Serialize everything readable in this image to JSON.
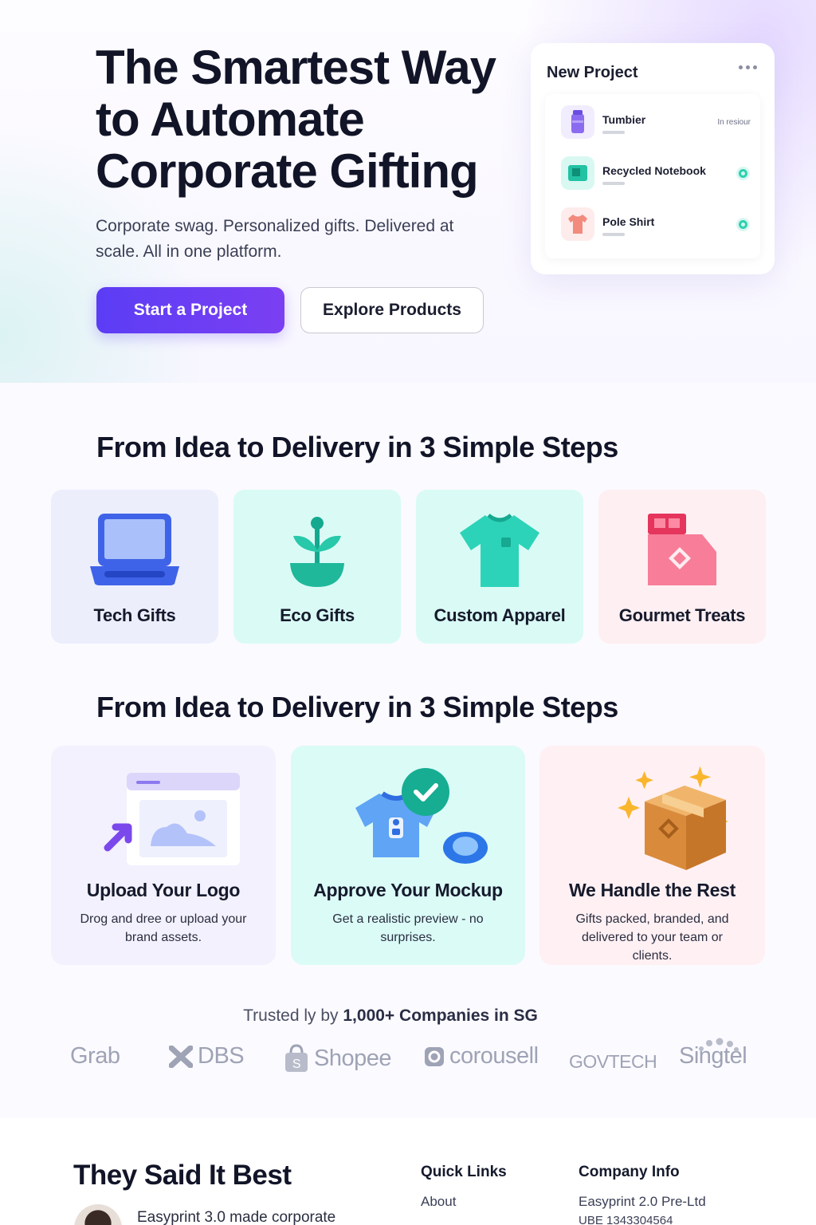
{
  "hero": {
    "title": "The Smartest Way to Automate Corporate Gifting",
    "subtitle": "Corporate swag. Personalized gifts. Delivered at scale. All in one platform.",
    "primary_cta": "Start a Project",
    "secondary_cta": "Explore Products"
  },
  "project_card": {
    "title": "New Project",
    "items": [
      {
        "name": "Tumbier",
        "status": "In resiour",
        "color": "#8b6cf0"
      },
      {
        "name": "Recycled Notebook",
        "status": "",
        "color": "#2fd1b0"
      },
      {
        "name": "Pole Shirt",
        "status": "",
        "color": "#f28b7d"
      }
    ]
  },
  "categories": {
    "title": "From Idea to Delivery in 3 Simple Steps",
    "items": [
      {
        "label": "Tech Gifts",
        "icon": "laptop-icon",
        "bg": "#eceefc"
      },
      {
        "label": "Eco Gifts",
        "icon": "plant-icon",
        "bg": "#dafbf5"
      },
      {
        "label": "Custom Apparel",
        "icon": "tshirt-icon",
        "bg": "#dafbf5"
      },
      {
        "label": "Gourmet Treats",
        "icon": "gift-box-icon",
        "bg": "#feeff2"
      }
    ]
  },
  "steps": {
    "title": "From Idea to Delivery in 3 Simple Steps",
    "items": [
      {
        "title": "Upload Your Logo",
        "desc": "Drog and dree or upload your brand assets.",
        "bg": "#f3f1fd"
      },
      {
        "title": "Approve Your Mockup",
        "desc": "Get a realistic preview - no surprises.",
        "bg": "#dbfbf7"
      },
      {
        "title": "We Handle the Rest",
        "desc": "Gifts packed, branded, and delivered to your team or clients.",
        "bg": "#fff0f3"
      }
    ]
  },
  "trusted": {
    "prefix": "Trusted ly by ",
    "highlight": "1,000+ Companies in SG",
    "logos": [
      "Grab",
      "DBS",
      "Shopee",
      "corousell",
      "GOVTECH",
      "Singtel"
    ]
  },
  "footer": {
    "testimonials_title": "They Said It Best",
    "quote": "Easyprint 3.0 made corporate",
    "quick_links_title": "Quick Links",
    "quick_links": [
      "About"
    ],
    "company_info_title": "Company Info",
    "company_name": "Easyprint 2.0 Pre-Ltd",
    "company_uen": "UBE 1343304564"
  }
}
